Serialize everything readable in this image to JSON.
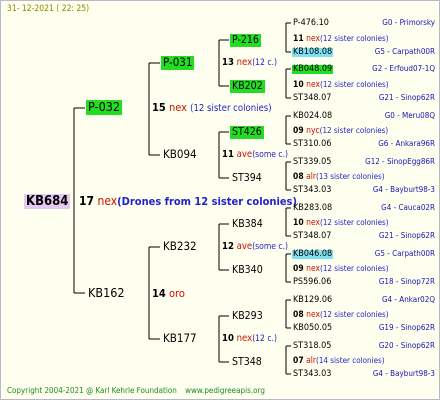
{
  "date": "31- 12-2021 ( 22: 25)",
  "copyright": "Copyright 2004-2021 @ Karl Kehrle Foundation",
  "website": "www.pedigreeapis.org",
  "root": {
    "label": "KB684",
    "num": "17",
    "year": "nex",
    "colonies": "(Drones from 12 sister colonies)"
  },
  "gen1": [
    {
      "label": "P-032",
      "num": "15",
      "year": "nex",
      "colonies": "(12 sister colonies)"
    },
    {
      "label": "KB162",
      "num": "14",
      "year": "oro",
      "colonies": ""
    }
  ],
  "gen2": [
    {
      "label": "P-031",
      "num": "13",
      "year": "nex",
      "colonies": "(12 c.)"
    },
    {
      "label": "KB094",
      "num": "11",
      "year": "ave",
      "colonies": "(some c.)"
    },
    {
      "label": "KB232",
      "num": "12",
      "year": "ave",
      "colonies": "(some c.)"
    },
    {
      "label": "KB177",
      "num": "10",
      "year": "nex",
      "colonies": "(12 c.)"
    }
  ],
  "gen3": [
    {
      "label": "P-216",
      "num": "11",
      "year": "nex",
      "colonies": "(12 sister colonies)"
    },
    {
      "label": "KB202",
      "num": "10",
      "year": "nex",
      "colonies": "(12 sister colonies)"
    },
    {
      "label": "ST426",
      "num": "09",
      "year": "nyc",
      "colonies": "(12 sister colonies)"
    },
    {
      "label": "ST394",
      "num": "08",
      "year": "alr",
      "colonies": "(13 sister colonies)"
    },
    {
      "label": "KB384",
      "num": "10",
      "year": "nex",
      "colonies": "(12 sister colonies)"
    },
    {
      "label": "KB340",
      "num": "09",
      "year": "nex",
      "colonies": "(12 sister colonies)"
    },
    {
      "label": "KB293",
      "num": "08",
      "year": "nex",
      "colonies": "(12 sister colonies)"
    },
    {
      "label": "ST348",
      "num": "07",
      "year": "alr",
      "colonies": "(14 sister colonies)"
    }
  ],
  "gen4": [
    {
      "label": "P-476.10",
      "loc": "G0 - Primorsky"
    },
    {
      "label": "KB108.08",
      "loc": "G5 - Carpath00R"
    },
    {
      "label": "KB048.09",
      "loc": "G2 - Erfoud07-1Q"
    },
    {
      "label": "ST348.07",
      "loc": "G21 - Sinop62R"
    },
    {
      "label": "KB024.08",
      "loc": "G0 - Meru08Q"
    },
    {
      "label": "ST310.06",
      "loc": "G6 - Ankara96R"
    },
    {
      "label": "ST339.05",
      "loc": "G12 - SinopEgg86R"
    },
    {
      "label": "ST343.03",
      "loc": "G4 - Bayburt98-3"
    },
    {
      "label": "KB283.08",
      "loc": "G4 - Cauca02R"
    },
    {
      "label": "ST348.07",
      "loc": "G21 - Sinop62R"
    },
    {
      "label": "KB046.08",
      "loc": "G5 - Carpath00R"
    },
    {
      "label": "PS596.06",
      "loc": "G18 - Sinop72R"
    },
    {
      "label": "KB129.06",
      "loc": "G4 - Ankar02Q"
    },
    {
      "label": "KB050.05",
      "loc": "G19 - Sinop62R"
    },
    {
      "label": "ST318.05",
      "loc": "G20 - Sinop62R"
    },
    {
      "label": "ST343.03",
      "loc": "G4 - Bayburt98-3"
    }
  ],
  "colors": {
    "highlight_green": "#22dd22",
    "highlight_cyan": "#7fe0f0",
    "root_bg": "#e6c8f2"
  }
}
